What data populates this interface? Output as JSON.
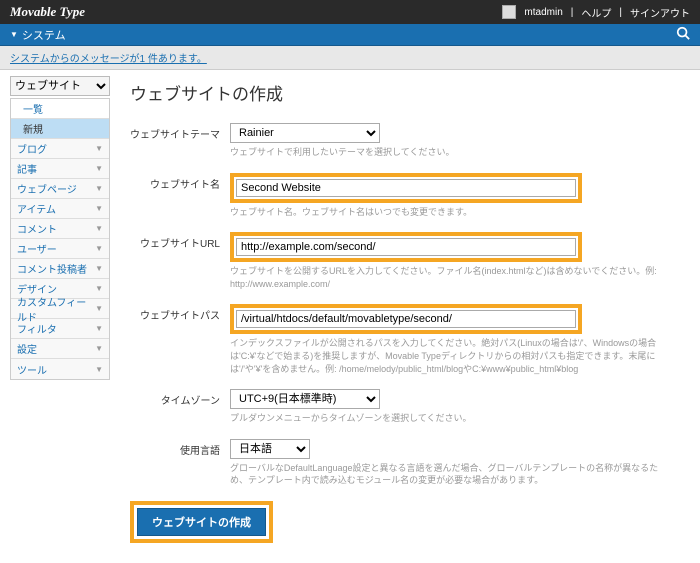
{
  "topbar": {
    "brand": "Movable Type",
    "user": "mtadmin",
    "help": "ヘルプ",
    "signout": "サインアウト"
  },
  "navbar": {
    "system": "システム"
  },
  "msgbar": {
    "link": "システムからのメッセージが1 件あります。"
  },
  "sidebar": {
    "selector": "ウェブサイト",
    "items": [
      {
        "label": "一覧",
        "sub": true
      },
      {
        "label": "新規",
        "sub": true,
        "active": true
      },
      {
        "label": "ブログ"
      },
      {
        "label": "記事"
      },
      {
        "label": "ウェブページ"
      },
      {
        "label": "アイテム"
      },
      {
        "label": "コメント"
      },
      {
        "label": "ユーザー"
      },
      {
        "label": "コメント投稿者"
      },
      {
        "label": "デザイン"
      },
      {
        "label": "カスタムフィールド"
      },
      {
        "label": "フィルタ"
      },
      {
        "label": "設定"
      },
      {
        "label": "ツール"
      }
    ]
  },
  "page": {
    "title": "ウェブサイトの作成",
    "theme": {
      "label": "ウェブサイトテーマ",
      "value": "Rainier",
      "hint": "ウェブサイトで利用したいテーマを選択してください。"
    },
    "name": {
      "label": "ウェブサイト名",
      "value": "Second Website",
      "hint": "ウェブサイト名。ウェブサイト名はいつでも変更できます。"
    },
    "url": {
      "label": "ウェブサイトURL",
      "value": "http://example.com/second/",
      "hint": "ウェブサイトを公開するURLを入力してください。ファイル名(index.htmlなど)は含めないでください。例: http://www.example.com/"
    },
    "path": {
      "label": "ウェブサイトパス",
      "value": "/virtual/htdocs/default/movabletype/second/",
      "hint": "インデックスファイルが公開されるパスを入力してください。絶対パス(Linuxの場合は'/'、Windowsの場合は'C:¥'などで始まる)を推奨しますが、Movable Typeディレクトリからの相対パスも指定できます。末尾には'/'や'¥'を含めません。例: /home/melody/public_html/blogやC:¥www¥public_html¥blog"
    },
    "tz": {
      "label": "タイムゾーン",
      "value": "UTC+9(日本標準時)",
      "hint": "プルダウンメニューからタイムゾーンを選択してください。"
    },
    "lang": {
      "label": "使用言語",
      "value": "日本語",
      "hint": "グローバルなDefaultLanguage設定と異なる言語を選んだ場合、グローバルテンプレートの名称が異なるため、テンプレート内で読み込むモジュール名の変更が必要な場合があります。"
    },
    "submit": "ウェブサイトの作成"
  }
}
